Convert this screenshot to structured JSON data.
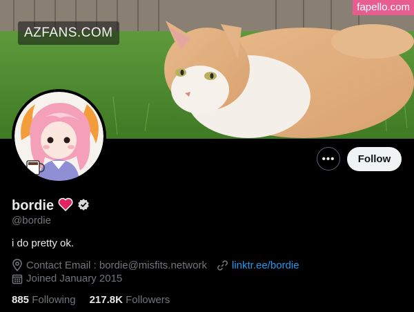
{
  "watermarks": {
    "left": "AZFANS.COM",
    "right": "fapello.com"
  },
  "profile": {
    "display_name": "bordie",
    "handle": "@bordie",
    "bio": "i do pretty ok.",
    "location": "Contact Email : bordie@misfits.network",
    "website": "linktr.ee/bordie",
    "joined": "Joined January 2015"
  },
  "actions": {
    "more_label": "•••",
    "follow_label": "Follow"
  },
  "stats": {
    "following_count": "885",
    "following_label": "Following",
    "followers_count": "217.8K",
    "followers_label": "Followers"
  },
  "icons": {
    "more": "more-horizontal-icon",
    "heart": "heart-emoji-icon",
    "verified": "verified-badge-icon",
    "location": "location-pin-icon",
    "link": "link-icon",
    "calendar": "calendar-icon"
  },
  "colors": {
    "background": "#000000",
    "follow_bg": "#eff3f4",
    "link": "#1d9bf0",
    "secondary_text": "#71767b",
    "heart": "#e0245e",
    "watermark_right_bg": "#e85d8f"
  }
}
